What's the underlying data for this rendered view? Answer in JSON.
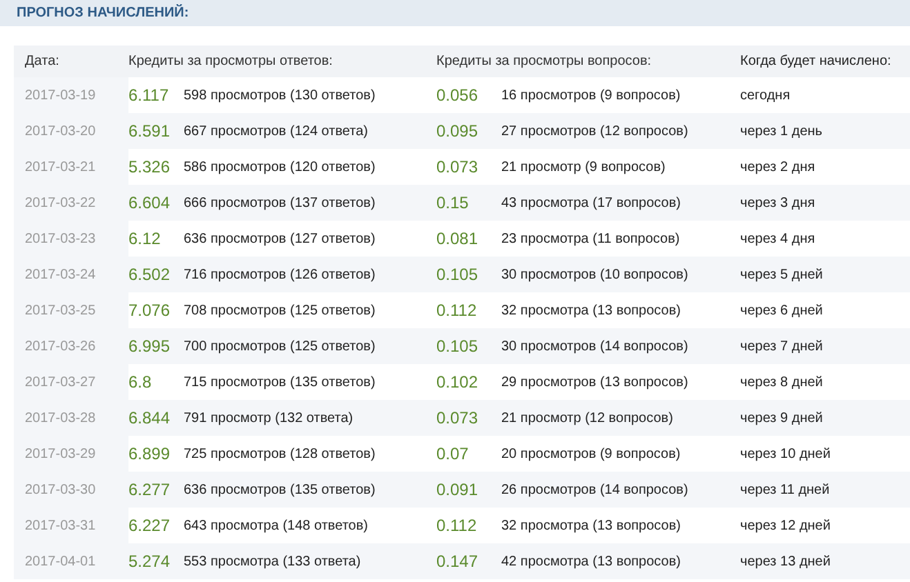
{
  "title": "ПРОГНОЗ НАЧИСЛЕНИЙ:",
  "table": {
    "columns": [
      "Дата:",
      "Кредиты за просмотры ответов:",
      "Кредиты за просмотры вопросов:",
      "Когда будет начислено:"
    ],
    "rows": [
      {
        "date": "2017-03-19",
        "answer_credits": "6.117",
        "answer_views": "598 просмотров (130 ответов)",
        "question_credits": "0.056",
        "question_views": "16 просмотров (9 вопросов)",
        "when": "сегодня"
      },
      {
        "date": "2017-03-20",
        "answer_credits": "6.591",
        "answer_views": "667 просмотров (124 ответа)",
        "question_credits": "0.095",
        "question_views": "27 просмотров (12 вопросов)",
        "when": "через 1 день"
      },
      {
        "date": "2017-03-21",
        "answer_credits": "5.326",
        "answer_views": "586 просмотров (120 ответов)",
        "question_credits": "0.073",
        "question_views": "21 просмотр (9 вопросов)",
        "when": "через 2 дня"
      },
      {
        "date": "2017-03-22",
        "answer_credits": "6.604",
        "answer_views": "666 просмотров (137 ответов)",
        "question_credits": "0.15",
        "question_views": "43 просмотра (17 вопросов)",
        "when": "через 3 дня"
      },
      {
        "date": "2017-03-23",
        "answer_credits": "6.12",
        "answer_views": "636 просмотров (127 ответов)",
        "question_credits": "0.081",
        "question_views": "23 просмотра (11 вопросов)",
        "when": "через 4 дня"
      },
      {
        "date": "2017-03-24",
        "answer_credits": "6.502",
        "answer_views": "716 просмотров (126 ответов)",
        "question_credits": "0.105",
        "question_views": "30 просмотров (10 вопросов)",
        "when": "через 5 дней"
      },
      {
        "date": "2017-03-25",
        "answer_credits": "7.076",
        "answer_views": "708 просмотров (125 ответов)",
        "question_credits": "0.112",
        "question_views": "32 просмотра (13 вопросов)",
        "when": "через 6 дней"
      },
      {
        "date": "2017-03-26",
        "answer_credits": "6.995",
        "answer_views": "700 просмотров (125 ответов)",
        "question_credits": "0.105",
        "question_views": "30 просмотров (14 вопросов)",
        "when": "через 7 дней"
      },
      {
        "date": "2017-03-27",
        "answer_credits": "6.8",
        "answer_views": "715 просмотров (135 ответов)",
        "question_credits": "0.102",
        "question_views": "29 просмотров (13 вопросов)",
        "when": "через 8 дней"
      },
      {
        "date": "2017-03-28",
        "answer_credits": "6.844",
        "answer_views": "791 просмотр (132 ответа)",
        "question_credits": "0.073",
        "question_views": "21 просмотр (12 вопросов)",
        "when": "через 9 дней"
      },
      {
        "date": "2017-03-29",
        "answer_credits": "6.899",
        "answer_views": "725 просмотров (128 ответов)",
        "question_credits": "0.07",
        "question_views": "20 просмотров (9 вопросов)",
        "when": "через 10 дней"
      },
      {
        "date": "2017-03-30",
        "answer_credits": "6.277",
        "answer_views": "636 просмотров (135 ответов)",
        "question_credits": "0.091",
        "question_views": "26 просмотров (14 вопросов)",
        "when": "через 11 дней"
      },
      {
        "date": "2017-03-31",
        "answer_credits": "6.227",
        "answer_views": "643 просмотра (148 ответов)",
        "question_credits": "0.112",
        "question_views": "32 просмотра (13 вопросов)",
        "when": "через 12 дней"
      },
      {
        "date": "2017-04-01",
        "answer_credits": "5.274",
        "answer_views": "553 просмотра (133 ответа)",
        "question_credits": "0.147",
        "question_views": "42 просмотра (13 вопросов)",
        "when": "через 13 дней"
      }
    ]
  }
}
